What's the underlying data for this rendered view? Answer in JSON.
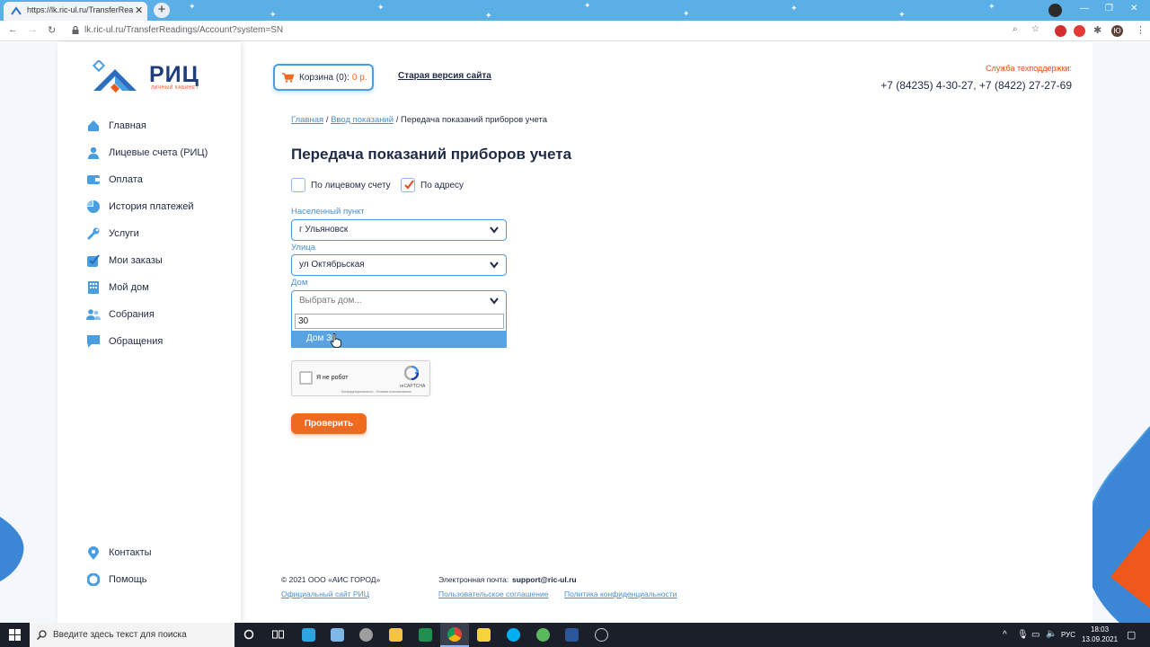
{
  "browser": {
    "tab_title": "https://lk.ric-ul.ru/TransferReadi...",
    "tab_close": "✕",
    "new_tab": "+",
    "url": "lk.ric-ul.ru/TransferReadings/Account?system=SN",
    "avatar_letter": "Ю"
  },
  "logo": {
    "name": "РИЦ",
    "subtitle": "личный кабинет"
  },
  "sidebar": {
    "items": [
      {
        "label": "Главная",
        "icon": "home-icon"
      },
      {
        "label": "Лицевые счета (РИЦ)",
        "icon": "user-icon"
      },
      {
        "label": "Оплата",
        "icon": "wallet-icon"
      },
      {
        "label": "История платежей",
        "icon": "pie-chart-icon"
      },
      {
        "label": "Услуги",
        "icon": "wrench-icon"
      },
      {
        "label": "Мои заказы",
        "icon": "checkbox-icon"
      },
      {
        "label": "Мой дом",
        "icon": "building-icon"
      },
      {
        "label": "Собрания",
        "icon": "people-icon"
      },
      {
        "label": "Обращения",
        "icon": "chat-icon"
      }
    ],
    "bottom": [
      {
        "label": "Контакты",
        "icon": "location-icon"
      },
      {
        "label": "Помощь",
        "icon": "lifebuoy-icon"
      }
    ]
  },
  "header": {
    "cart_label": "Корзина",
    "cart_count": "(0):",
    "cart_price": "0 р.",
    "old_site": "Старая версия сайта",
    "support_label": "Служба техподдержки:",
    "support_phones": "+7 (84235) 4-30-27, +7 (8422) 27-27-69"
  },
  "breadcrumb": {
    "home": "Главная",
    "sep": "/",
    "readings": "Ввод показаний",
    "current": "Передача показаний приборов учета"
  },
  "form": {
    "title": "Передача показаний приборов учета",
    "by_account": "По лицевому счету",
    "by_address": "По адресу",
    "by_address_checked": true,
    "city_label": "Населенный пункт",
    "city_value": "г Ульяновск",
    "street_label": "Улица",
    "street_value": "ул Октябрьская",
    "house_label": "Дом",
    "house_placeholder": "Выбрать дом...",
    "house_search": "30",
    "house_option": "Дом 30",
    "captcha_text": "Я не робот",
    "captcha_brand": "reCAPTCHA",
    "captcha_terms": "Конфиденциальность - Условия использования",
    "submit": "Проверить"
  },
  "footer": {
    "copyright": "© 2021 ООО «АИС ГОРОД»",
    "official_site": "Официальный сайт РИЦ",
    "email_label": "Электронная почта:",
    "email": "support@ric-ul.ru",
    "agreement": "Пользовательское соглашение",
    "privacy": "Политика конфиденциальности"
  },
  "taskbar": {
    "search_placeholder": "Введите здесь текст для поиска",
    "lang": "РУС",
    "time": "18:03",
    "date": "13.09.2021"
  },
  "colors": {
    "accent": "#4a9ee0",
    "brand_dark": "#1f2a44",
    "orange": "#ee6a1f"
  }
}
